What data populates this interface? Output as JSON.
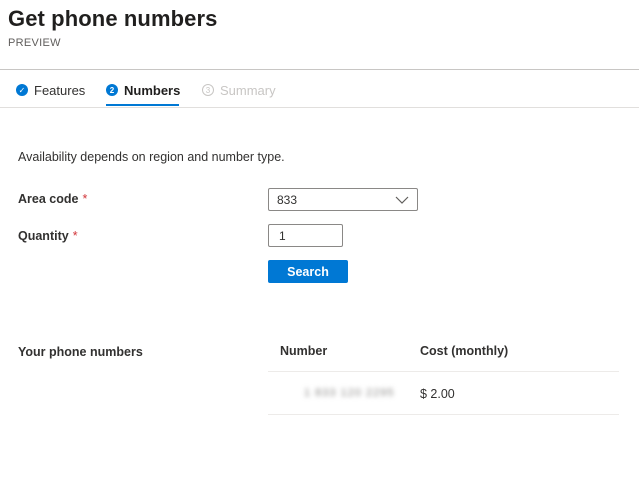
{
  "header": {
    "title": "Get phone numbers",
    "subtitle": "PREVIEW"
  },
  "tabs": [
    {
      "step": "✓",
      "label": "Features",
      "state": "completed"
    },
    {
      "step": "2",
      "label": "Numbers",
      "state": "active"
    },
    {
      "step": "3",
      "label": "Summary",
      "state": "disabled"
    }
  ],
  "form": {
    "info": "Availability depends on region and number type.",
    "area_code": {
      "label": "Area code",
      "required_mark": "*",
      "value": "833"
    },
    "quantity": {
      "label": "Quantity",
      "required_mark": "*",
      "value": "1"
    },
    "search_label": "Search"
  },
  "results": {
    "section_label": "Your phone numbers",
    "columns": [
      "Number",
      "Cost (monthly)"
    ],
    "rows": [
      {
        "number": "1 833 120 2295",
        "cost": "$ 2.00"
      }
    ]
  },
  "colors": {
    "accent": "#0078d4",
    "required": "#d13438"
  }
}
